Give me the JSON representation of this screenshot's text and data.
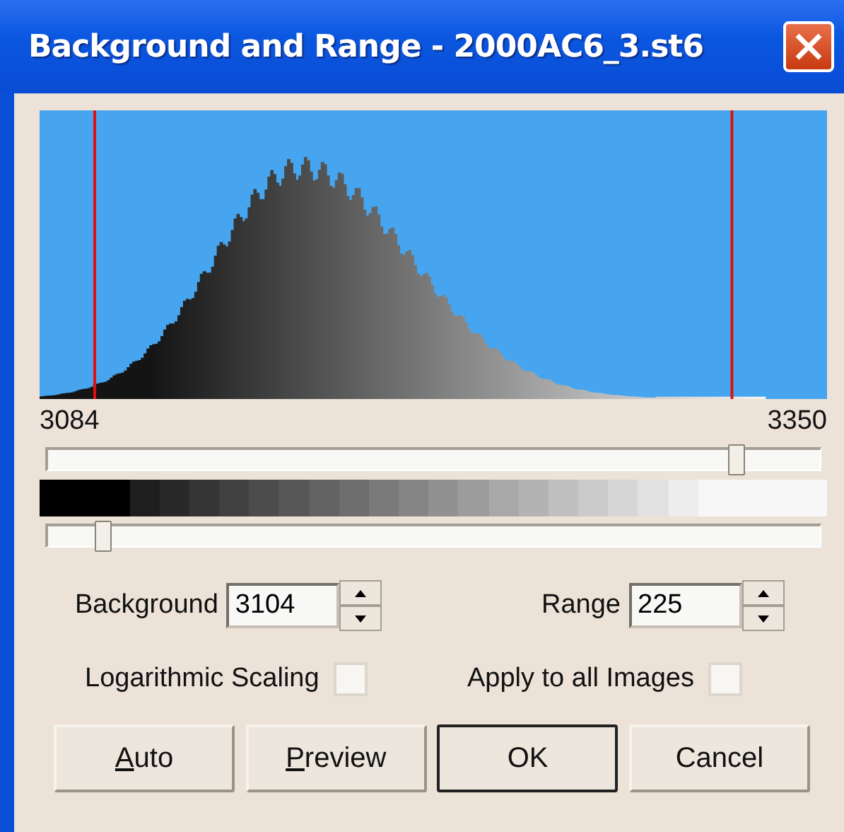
{
  "window": {
    "title": "Background and Range - 2000AC6_3.st6"
  },
  "histogram": {
    "min_label": "3084",
    "max_label": "3350"
  },
  "sliders": [
    {
      "level": 0.89
    },
    {
      "level": 0.07
    }
  ],
  "fields": [
    {
      "label": "Background",
      "value": "3104"
    },
    {
      "label": "Range",
      "value": "225"
    }
  ],
  "checkboxes": [
    {
      "label": "Logarithmic Scaling",
      "checked": false
    },
    {
      "label": "Apply to all Images",
      "checked": false
    }
  ],
  "buttons": [
    {
      "label": "Auto",
      "underline_first": true,
      "default": false
    },
    {
      "label": "Preview",
      "underline_first": true,
      "default": false
    },
    {
      "label": "OK",
      "underline_first": false,
      "default": true
    },
    {
      "label": "Cancel",
      "underline_first": false,
      "default": false
    }
  ]
}
